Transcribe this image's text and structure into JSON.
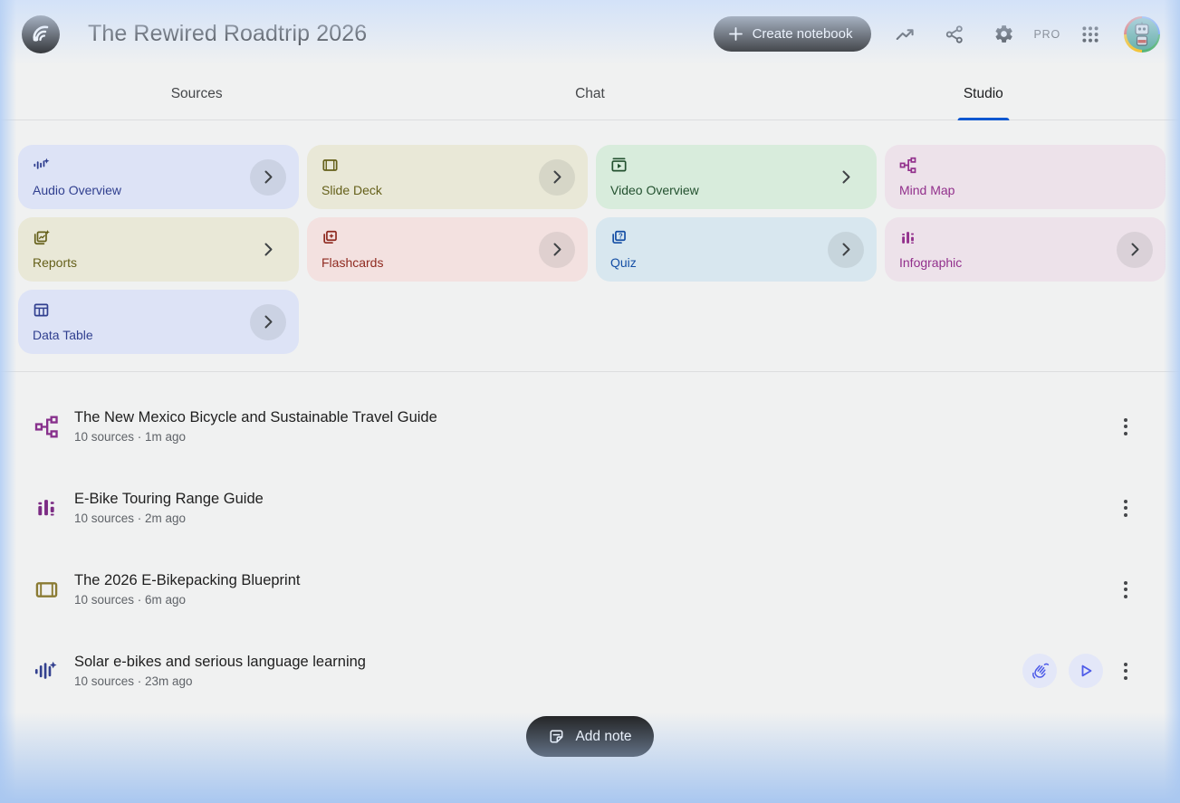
{
  "header": {
    "title": "The Rewired Roadtrip 2026",
    "create_button_label": "Create notebook",
    "pro_label": "PRO"
  },
  "tabs": [
    {
      "label": "Sources",
      "active": false
    },
    {
      "label": "Chat",
      "active": false
    },
    {
      "label": "Studio",
      "active": true
    }
  ],
  "studio_cards": [
    {
      "label": "Audio Overview",
      "icon": "audio-waveform-sparkle-icon",
      "bg": "#dde3f6",
      "fg": "#303f8f",
      "chevron": "circle"
    },
    {
      "label": "Slide Deck",
      "icon": "slide-deck-icon",
      "bg": "#e9e8d7",
      "fg": "#65601a",
      "chevron": "circle"
    },
    {
      "label": "Video Overview",
      "icon": "video-overview-icon",
      "bg": "#d8ecdc",
      "fg": "#23512f",
      "chevron": "plain"
    },
    {
      "label": "Mind Map",
      "icon": "mind-map-icon",
      "bg": "#ede2ea",
      "fg": "#92308c",
      "chevron": "none"
    },
    {
      "label": "Reports",
      "icon": "report-sparkle-icon",
      "bg": "#e9e8d7",
      "fg": "#65601a",
      "chevron": "plain"
    },
    {
      "label": "Flashcards",
      "icon": "flashcards-icon",
      "bg": "#f3e1e0",
      "fg": "#8f2a20",
      "chevron": "circle"
    },
    {
      "label": "Quiz",
      "icon": "quiz-icon",
      "bg": "#d8e7ef",
      "fg": "#154fa5",
      "chevron": "circle"
    },
    {
      "label": "Infographic",
      "icon": "infographic-bars-icon",
      "bg": "#ede2ea",
      "fg": "#92308c",
      "chevron": "circle"
    },
    {
      "label": "Data Table",
      "icon": "data-table-icon",
      "bg": "#dde3f6",
      "fg": "#303f8f",
      "chevron": "circle"
    }
  ],
  "artifacts": [
    {
      "title": "The New Mexico Bicycle and Sustainable Travel Guide",
      "meta": "10 sources · 1m ago",
      "icon": "mind-map-icon",
      "icon_color": "#87308c"
    },
    {
      "title": "E-Bike Touring Range Guide",
      "meta": "10 sources · 2m ago",
      "icon": "infographic-bars-icon",
      "icon_color": "#7c2c84"
    },
    {
      "title": "The 2026 E-Bikepacking Blueprint",
      "meta": "10 sources · 6m ago",
      "icon": "slide-deck-icon",
      "icon_color": "#8a7b33"
    },
    {
      "title": "Solar e-bikes and serious language learning",
      "meta": "10 sources · 23m ago",
      "icon": "audio-waveform-sparkle-icon",
      "icon_color": "#33418f",
      "actions": [
        "interactive-mode",
        "play"
      ]
    }
  ],
  "footer": {
    "add_note_label": "Add note"
  },
  "colors": {
    "accent_blue": "#0b57d0",
    "button_black": "#1f1f1f",
    "glow_blue": "#a9c7f0",
    "meta_gray": "#5f6368"
  }
}
